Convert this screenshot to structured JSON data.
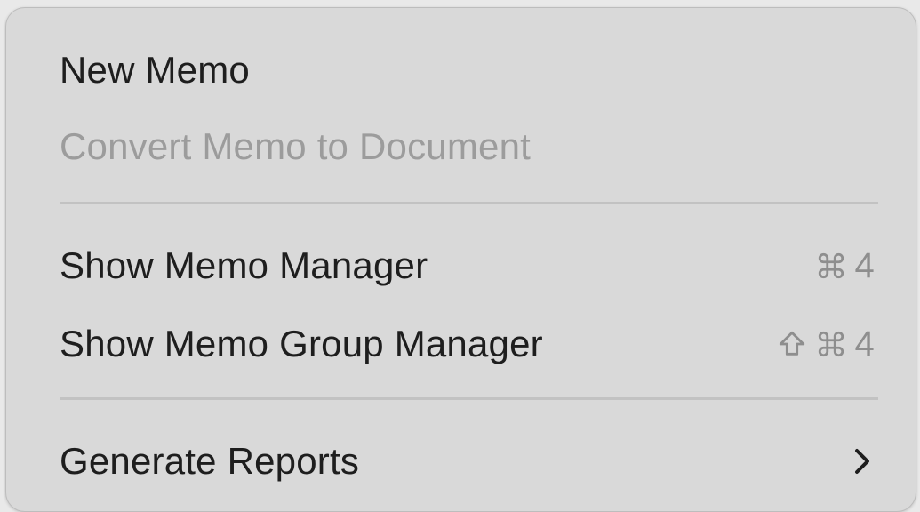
{
  "menu": {
    "items": [
      {
        "label": "New Memo",
        "enabled": true
      },
      {
        "label": "Convert Memo to Document",
        "enabled": false
      },
      {
        "label": "Show Memo Manager",
        "enabled": true,
        "shortcut": {
          "modifiers": [
            "command-icon"
          ],
          "key": "4"
        }
      },
      {
        "label": "Show Memo Group Manager",
        "enabled": true,
        "shortcut": {
          "modifiers": [
            "shift-icon",
            "command-icon"
          ],
          "key": "4"
        }
      },
      {
        "label": "Generate Reports",
        "enabled": true,
        "submenu_icon": "chevron-right-icon"
      }
    ]
  },
  "colors": {
    "menu_background": "#d9d9d9",
    "text": "#1e1e1e",
    "disabled_text": "#9c9c9c",
    "shortcut_text": "#8e8e8e",
    "separator": "#c2c2c2"
  }
}
